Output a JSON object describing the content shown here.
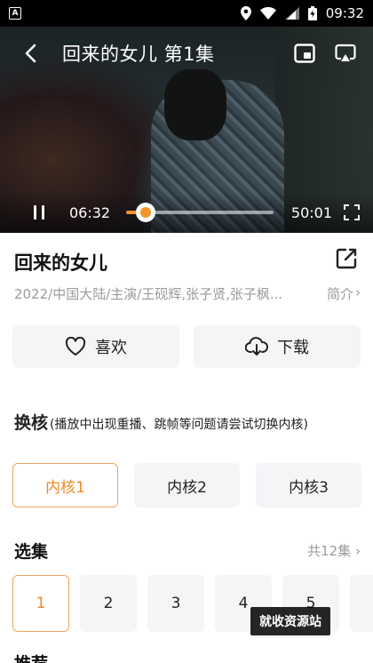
{
  "status_bar": {
    "time": "09:32",
    "icons": [
      "app-badge-icon",
      "location-icon",
      "wifi-icon",
      "signal-icon",
      "battery-icon"
    ]
  },
  "player": {
    "title": "回来的女儿 第1集",
    "current_time": "06:32",
    "duration": "50:01",
    "progress": 0.13,
    "accent_color": "#f5922b"
  },
  "show": {
    "title": "回来的女儿",
    "meta": "2022/中国大陆/主演/王砚辉,张子贤,张子枫...",
    "intro_label": "简介"
  },
  "actions": {
    "like_label": "喜欢",
    "download_label": "下载"
  },
  "kernel": {
    "title": "换核",
    "note": "(播放中出现重播、跳帧等问题请尝试切换内核)",
    "options": [
      "内核1",
      "内核2",
      "内核3"
    ],
    "selected": 0
  },
  "episodes": {
    "title": "选集",
    "count_label": "共12集",
    "items": [
      "1",
      "2",
      "3",
      "4",
      "5"
    ],
    "selected": 0
  },
  "watermark": "就收资源站",
  "next_section_title": "推荐"
}
